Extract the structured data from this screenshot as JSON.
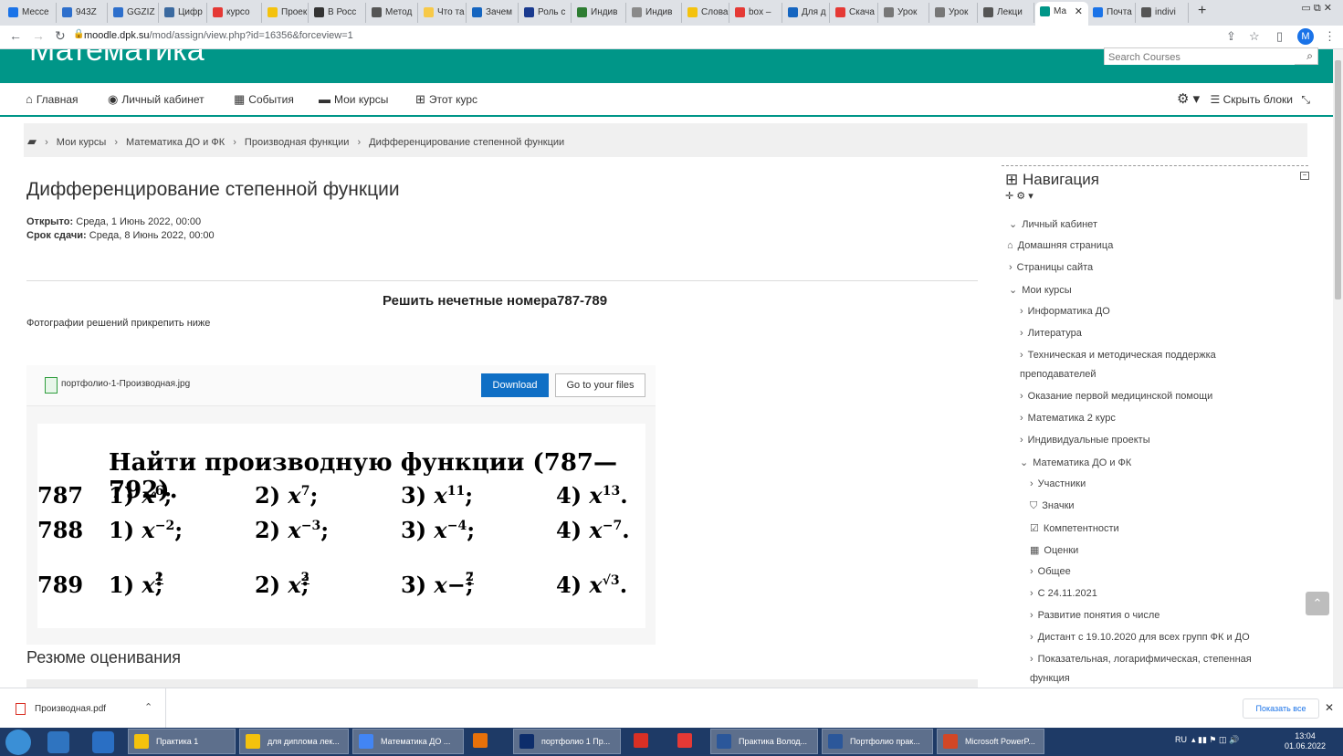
{
  "browser": {
    "tabs": [
      {
        "label": "Мессе",
        "color": "#1a73e8"
      },
      {
        "label": "943Z",
        "color": "#2d6fcc"
      },
      {
        "label": "GGZIZ",
        "color": "#2d6fcc"
      },
      {
        "label": "Цифр",
        "color": "#3b6aa0"
      },
      {
        "label": "курсо",
        "color": "#e53935"
      },
      {
        "label": "Проек",
        "color": "#f4c20d"
      },
      {
        "label": "В Росс",
        "color": "#333333"
      },
      {
        "label": "Метод",
        "color": "#555555"
      },
      {
        "label": "Что та",
        "color": "#f7c948"
      },
      {
        "label": "Зачем",
        "color": "#1565c0"
      },
      {
        "label": "Роль с",
        "color": "#1a3a8f"
      },
      {
        "label": "Индив",
        "color": "#2e7d32"
      },
      {
        "label": "Индив",
        "color": "#8a8a8a"
      },
      {
        "label": "Слова",
        "color": "#f4c20d"
      },
      {
        "label": "box –",
        "color": "#e53935"
      },
      {
        "label": "Для д",
        "color": "#1565c0"
      },
      {
        "label": "Скача",
        "color": "#e53935"
      },
      {
        "label": "Урок",
        "color": "#777777"
      },
      {
        "label": "Урок",
        "color": "#777777"
      },
      {
        "label": "Лекци",
        "color": "#555555"
      },
      {
        "label": "Ма",
        "color": "#009688"
      },
      {
        "label": "Почта",
        "color": "#1a73e8"
      },
      {
        "label": "indivi",
        "color": "#555555"
      }
    ],
    "new_tab": "+",
    "url_host": "moodle.dpk.su",
    "url_path": "/mod/assign/view.php?id=16356&forceview=1",
    "profile_initial": "M"
  },
  "site": {
    "title": "Математика",
    "search_placeholder": "Search Courses"
  },
  "menu": {
    "home": "Главная",
    "dashboard": "Личный кабинет",
    "events": "События",
    "my_courses": "Мои курсы",
    "this_course": "Этот курс",
    "hide_blocks": "Скрыть блоки"
  },
  "breadcrumb": [
    "Мои курсы",
    "Математика ДО и ФК",
    "Производная функции",
    "Дифференцирование степенной функции"
  ],
  "assignment": {
    "title": "Дифференцирование степенной функции",
    "opened_label": "Открыто:",
    "opened_value": "Среда, 1 Июнь 2022, 00:00",
    "due_label": "Срок сдачи:",
    "due_value": "Среда, 8 Июнь 2022, 00:00",
    "task": "Решить нечетные  номера787-789",
    "note": "Фотографии решений прикрепить ниже",
    "file_name": "портфолио-1-Производная.jpg",
    "download_label": "Download",
    "to_files_label": "Go to your files",
    "summary_title": "Резюме оценивания"
  },
  "math_image": {
    "heading": "Найти производную функции (787—792).",
    "rows": [
      {
        "num": "787",
        "items": [
          [
            "1)",
            "x",
            "6",
            ";"
          ],
          [
            "2)",
            "x",
            "7",
            ";"
          ],
          [
            "3)",
            "x",
            "11",
            ";"
          ],
          [
            "4)",
            "x",
            "13",
            "."
          ]
        ]
      },
      {
        "num": "788",
        "items": [
          [
            "1)",
            "x",
            "−2",
            ";"
          ],
          [
            "2)",
            "x",
            "−3",
            ";"
          ],
          [
            "3)",
            "x",
            "−4",
            ";"
          ],
          [
            "4)",
            "x",
            "−7",
            "."
          ]
        ]
      },
      {
        "num": "789",
        "items": [
          [
            "1)",
            "x",
            "1/2",
            ";"
          ],
          [
            "2)",
            "x",
            "2/3",
            ";"
          ],
          [
            "3)",
            "x",
            "−2/7",
            ";"
          ],
          [
            "4)",
            "x",
            "√3",
            "."
          ]
        ]
      }
    ]
  },
  "navigation": {
    "title": "Навигация",
    "items": [
      {
        "label": "Личный кабинет",
        "icon": "chevron-down"
      },
      {
        "label": "Домашняя страница",
        "icon": "home"
      },
      {
        "label": "Страницы сайта",
        "icon": "chevron-right"
      },
      {
        "label": "Мои курсы",
        "icon": "chevron-down"
      },
      {
        "label": "Информатика ДО",
        "icon": "chevron-right"
      },
      {
        "label": "Литература",
        "icon": "chevron-right"
      },
      {
        "label": "Техническая и методическая поддержка",
        "icon": "chevron-right"
      },
      {
        "label": "преподавателей",
        "icon": ""
      },
      {
        "label": "Оказание первой медицинской помощи",
        "icon": "chevron-right"
      },
      {
        "label": "Математика 2 курс",
        "icon": "chevron-right"
      },
      {
        "label": "Индивидуальные проекты",
        "icon": "chevron-right"
      },
      {
        "label": "Математика ДО и ФК",
        "icon": "chevron-down"
      },
      {
        "label": "Участники",
        "icon": "chevron-right"
      },
      {
        "label": "Значки",
        "icon": "shield"
      },
      {
        "label": "Компетентности",
        "icon": "check-square"
      },
      {
        "label": "Оценки",
        "icon": "table"
      },
      {
        "label": "Общее",
        "icon": "chevron-right"
      },
      {
        "label": "С 24.11.2021",
        "icon": "chevron-right"
      },
      {
        "label": "Развитие понятия о числе",
        "icon": "chevron-right"
      },
      {
        "label": "Дистант с 19.10.2020 для всех групп ФК и ДО",
        "icon": "chevron-right"
      },
      {
        "label": "Показательная, логарифмическая, степенная",
        "icon": "chevron-right"
      },
      {
        "label": "функция",
        "icon": ""
      }
    ]
  },
  "downloads": {
    "file": "Производная.pdf",
    "show_all": "Показать все"
  },
  "taskbar": {
    "tasks": [
      "Практика 1",
      "для диплома лек...",
      "Математика ДО ...",
      "",
      "портфолио 1 Пр...",
      "",
      "",
      "Практика Волод...",
      "Портфолио прак...",
      "Microsoft PowerP..."
    ],
    "lang": "RU",
    "time": "13:04",
    "date": "01.06.2022"
  }
}
